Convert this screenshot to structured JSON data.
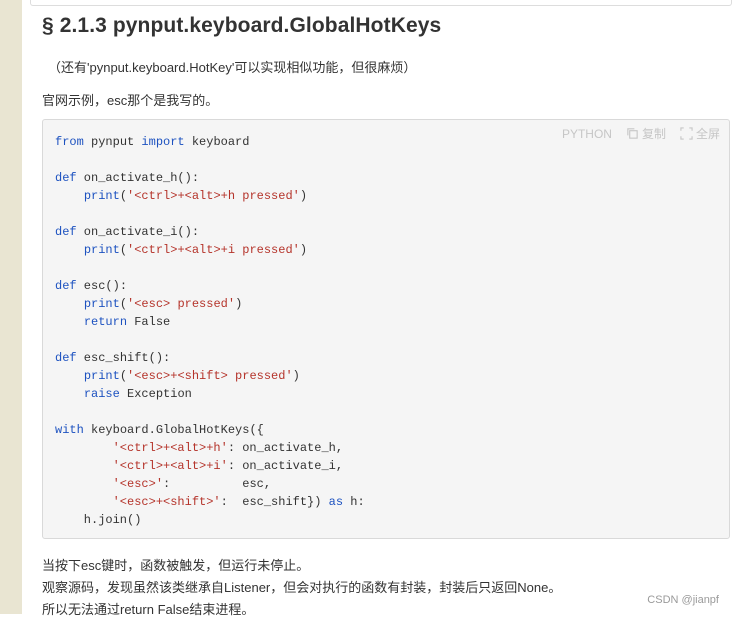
{
  "heading": "§ 2.1.3 pynput.keyboard.GlobalHotKeys",
  "note": "（还有'pynput.keyboard.HotKey'可以实现相似功能，但很麻烦）",
  "intro": "官网示例，esc那个是我写的。",
  "code_toolbar": {
    "language": "PYTHON",
    "copy_label": "复制",
    "fullscreen_label": "全屏"
  },
  "code_lines": [
    [
      {
        "t": "kw",
        "s": "from"
      },
      {
        "t": "",
        "s": " pynput "
      },
      {
        "t": "kw",
        "s": "import"
      },
      {
        "t": "",
        "s": " keyboard"
      }
    ],
    [],
    [
      {
        "t": "kw",
        "s": "def"
      },
      {
        "t": "",
        "s": " on_activate_h():"
      }
    ],
    [
      {
        "t": "",
        "s": "    "
      },
      {
        "t": "kw",
        "s": "print"
      },
      {
        "t": "",
        "s": "("
      },
      {
        "t": "str",
        "s": "'<ctrl>+<alt>+h pressed'"
      },
      {
        "t": "",
        "s": ")"
      }
    ],
    [],
    [
      {
        "t": "kw",
        "s": "def"
      },
      {
        "t": "",
        "s": " on_activate_i():"
      }
    ],
    [
      {
        "t": "",
        "s": "    "
      },
      {
        "t": "kw",
        "s": "print"
      },
      {
        "t": "",
        "s": "("
      },
      {
        "t": "str",
        "s": "'<ctrl>+<alt>+i pressed'"
      },
      {
        "t": "",
        "s": ")"
      }
    ],
    [],
    [
      {
        "t": "kw",
        "s": "def"
      },
      {
        "t": "",
        "s": " esc():"
      }
    ],
    [
      {
        "t": "",
        "s": "    "
      },
      {
        "t": "kw",
        "s": "print"
      },
      {
        "t": "",
        "s": "("
      },
      {
        "t": "str",
        "s": "'<esc> pressed'"
      },
      {
        "t": "",
        "s": ")"
      }
    ],
    [
      {
        "t": "",
        "s": "    "
      },
      {
        "t": "kw",
        "s": "return"
      },
      {
        "t": "",
        "s": " False"
      }
    ],
    [],
    [
      {
        "t": "kw",
        "s": "def"
      },
      {
        "t": "",
        "s": " esc_shift():"
      }
    ],
    [
      {
        "t": "",
        "s": "    "
      },
      {
        "t": "kw",
        "s": "print"
      },
      {
        "t": "",
        "s": "("
      },
      {
        "t": "str",
        "s": "'<esc>+<shift> pressed'"
      },
      {
        "t": "",
        "s": ")"
      }
    ],
    [
      {
        "t": "",
        "s": "    "
      },
      {
        "t": "kw",
        "s": "raise"
      },
      {
        "t": "",
        "s": " Exception"
      }
    ],
    [],
    [
      {
        "t": "kw",
        "s": "with"
      },
      {
        "t": "",
        "s": " keyboard.GlobalHotKeys({"
      }
    ],
    [
      {
        "t": "",
        "s": "        "
      },
      {
        "t": "str",
        "s": "'<ctrl>+<alt>+h'"
      },
      {
        "t": "",
        "s": ": on_activate_h,"
      }
    ],
    [
      {
        "t": "",
        "s": "        "
      },
      {
        "t": "str",
        "s": "'<ctrl>+<alt>+i'"
      },
      {
        "t": "",
        "s": ": on_activate_i,"
      }
    ],
    [
      {
        "t": "",
        "s": "        "
      },
      {
        "t": "str",
        "s": "'<esc>'"
      },
      {
        "t": "",
        "s": ":          esc,"
      }
    ],
    [
      {
        "t": "",
        "s": "        "
      },
      {
        "t": "str",
        "s": "'<esc>+<shift>'"
      },
      {
        "t": "",
        "s": ":  esc_shift}) "
      },
      {
        "t": "kw",
        "s": "as"
      },
      {
        "t": "",
        "s": " h:"
      }
    ],
    [
      {
        "t": "",
        "s": "    h.join()"
      }
    ]
  ],
  "paragraphs": [
    "当按下esc键时，函数被触发，但运行未停止。",
    "观察源码，发现虽然该类继承自Listener，但会对执行的函数有封装，封装后只返回None。",
    "所以无法通过return False结束进程。"
  ],
  "watermark": "CSDN @jianpf",
  "colors": {
    "keyword": "#1d52c0",
    "string": "#b5342b",
    "sidebar": "#e9e5d2",
    "code_bg": "#f5f5f5"
  }
}
